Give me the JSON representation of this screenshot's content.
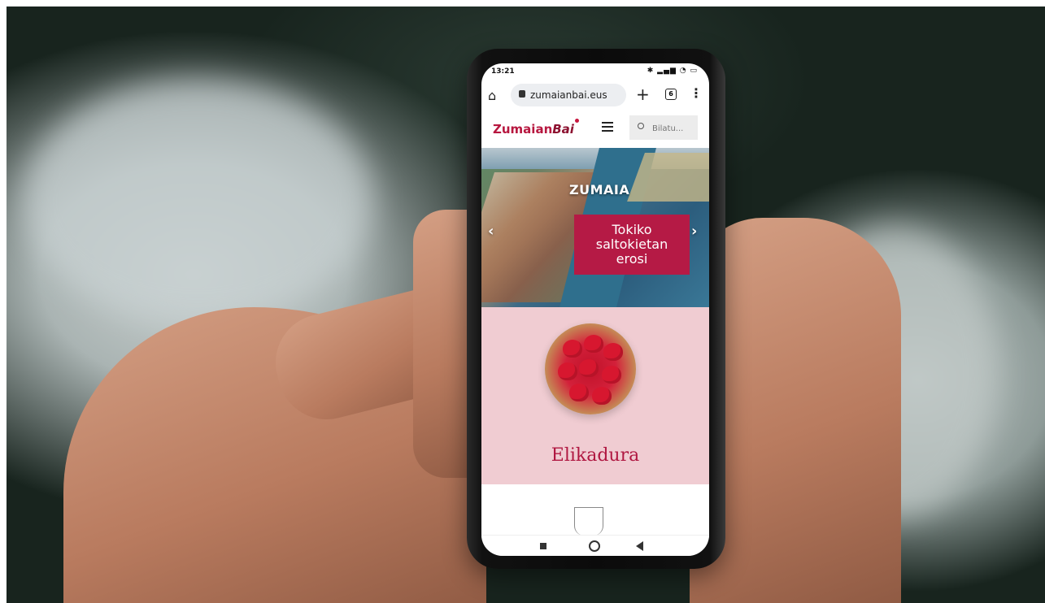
{
  "status_bar": {
    "time": "13:21",
    "icons": [
      "alarm-icon",
      "notification-icon",
      "bluetooth-icon",
      "signal-icon",
      "wifi-icon",
      "battery-icon"
    ]
  },
  "browser": {
    "url": "zumaianbai.eus",
    "tab_count": "6",
    "icons": [
      "home-icon",
      "lock-icon",
      "new-tab-icon",
      "tabs-icon",
      "menu-icon"
    ]
  },
  "site": {
    "logo": {
      "part1": "Zumaian",
      "part2": "Bai"
    },
    "search": {
      "placeholder": "Bilatu..."
    },
    "colors": {
      "brand": "#b51a45",
      "category_bg": "#f0ccd2"
    }
  },
  "hero": {
    "title": "ZUMAIA",
    "cta": "Tokiko\nsaltokietan\nerosi"
  },
  "category": {
    "title": "Elikadura"
  }
}
